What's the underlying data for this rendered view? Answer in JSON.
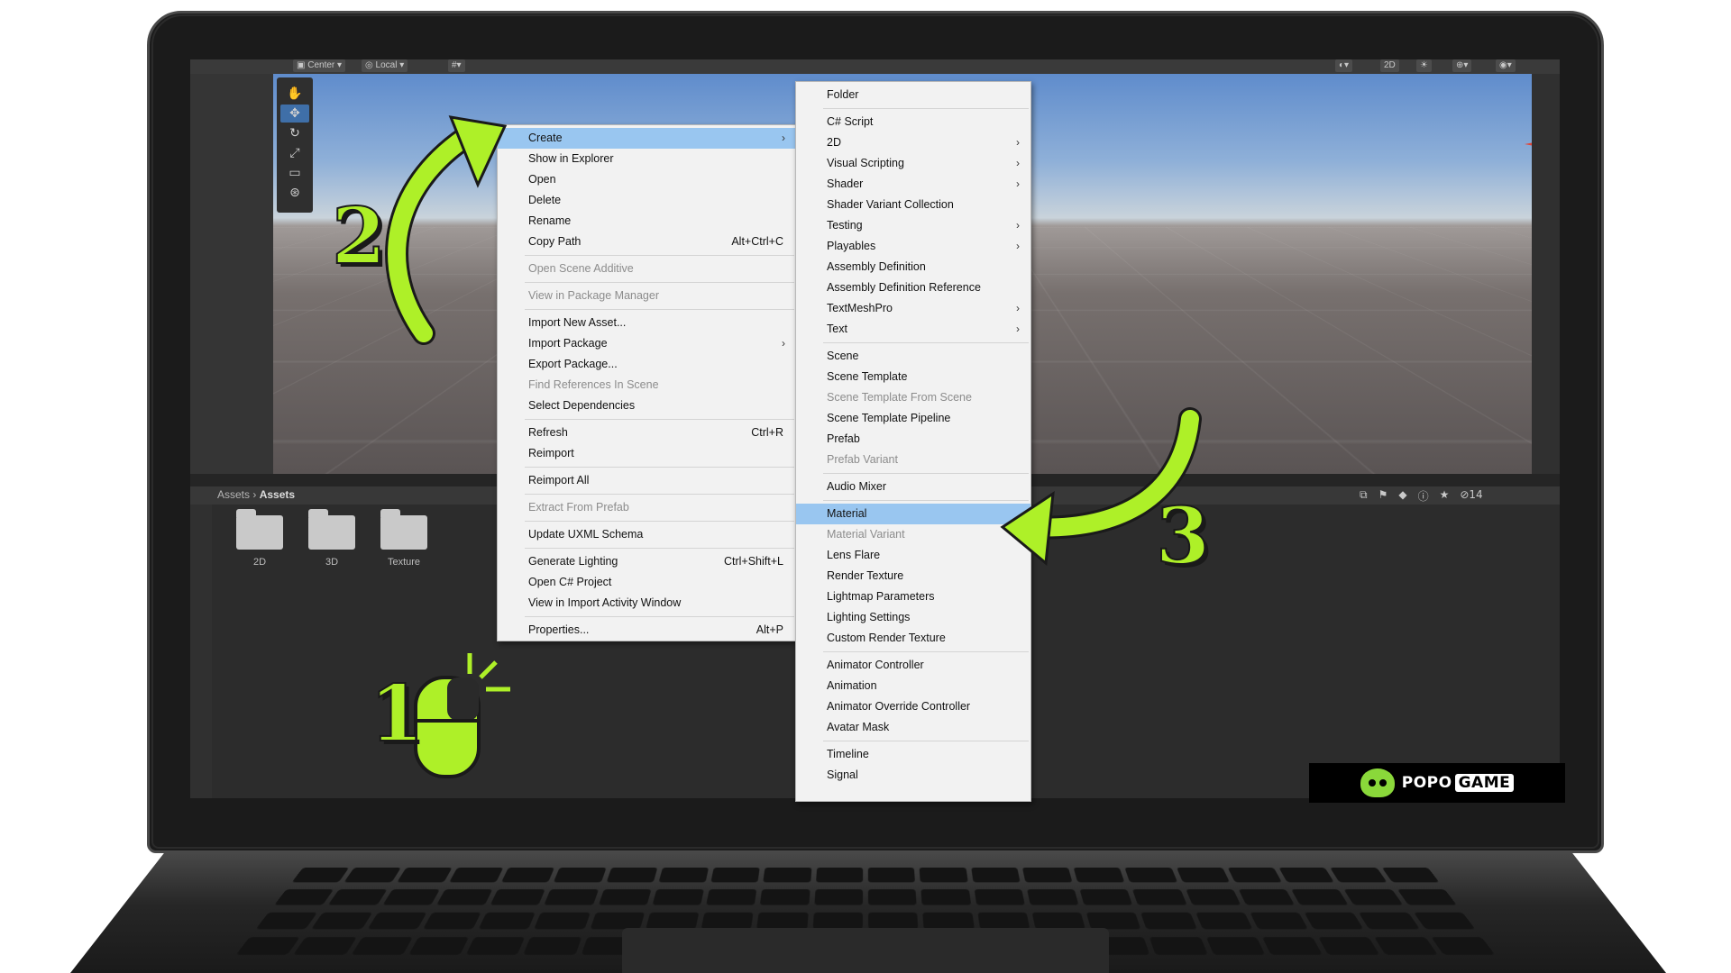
{
  "toolbar": {
    "pivot_center": "Center",
    "pivot_local": "Local",
    "mode_2d": "2D"
  },
  "project": {
    "breadcrumb_root": "Assets",
    "breadcrumb_current": "Assets",
    "folders": [
      "2D",
      "3D",
      "Texture"
    ],
    "visible_count": "14"
  },
  "context_menu": {
    "items": [
      {
        "label": "Create",
        "submenu": true,
        "highlighted": true
      },
      {
        "label": "Show in Explorer"
      },
      {
        "label": "Open"
      },
      {
        "label": "Delete"
      },
      {
        "label": "Rename"
      },
      {
        "label": "Copy Path",
        "shortcut": "Alt+Ctrl+C"
      },
      {
        "label": "Open Scene Additive",
        "disabled": true
      },
      {
        "label": "View in Package Manager",
        "disabled": true
      },
      {
        "label": "Import New Asset..."
      },
      {
        "label": "Import Package",
        "submenu": true
      },
      {
        "label": "Export Package..."
      },
      {
        "label": "Find References In Scene",
        "disabled": true
      },
      {
        "label": "Select Dependencies"
      },
      {
        "label": "Refresh",
        "shortcut": "Ctrl+R"
      },
      {
        "label": "Reimport"
      },
      {
        "label": "Reimport All"
      },
      {
        "label": "Extract From Prefab",
        "disabled": true
      },
      {
        "label": "Update UXML Schema"
      },
      {
        "label": "Generate Lighting",
        "shortcut": "Ctrl+Shift+L"
      },
      {
        "label": "Open C# Project"
      },
      {
        "label": "View in Import Activity Window"
      },
      {
        "label": "Properties...",
        "shortcut": "Alt+P"
      }
    ]
  },
  "create_submenu": {
    "items": [
      {
        "label": "Folder"
      },
      {
        "label": "C# Script"
      },
      {
        "label": "2D",
        "submenu": true
      },
      {
        "label": "Visual Scripting",
        "submenu": true
      },
      {
        "label": "Shader",
        "submenu": true
      },
      {
        "label": "Shader Variant Collection"
      },
      {
        "label": "Testing",
        "submenu": true
      },
      {
        "label": "Playables",
        "submenu": true
      },
      {
        "label": "Assembly Definition"
      },
      {
        "label": "Assembly Definition Reference"
      },
      {
        "label": "TextMeshPro",
        "submenu": true
      },
      {
        "label": "Text",
        "submenu": true
      },
      {
        "label": "Scene"
      },
      {
        "label": "Scene Template"
      },
      {
        "label": "Scene Template From Scene",
        "disabled": true
      },
      {
        "label": "Scene Template Pipeline"
      },
      {
        "label": "Prefab"
      },
      {
        "label": "Prefab Variant",
        "disabled": true
      },
      {
        "label": "Audio Mixer"
      },
      {
        "label": "Material",
        "highlighted": true
      },
      {
        "label": "Material Variant",
        "disabled": true
      },
      {
        "label": "Lens Flare"
      },
      {
        "label": "Render Texture"
      },
      {
        "label": "Lightmap Parameters"
      },
      {
        "label": "Lighting Settings"
      },
      {
        "label": "Custom Render Texture"
      },
      {
        "label": "Animator Controller"
      },
      {
        "label": "Animation"
      },
      {
        "label": "Animator Override Controller"
      },
      {
        "label": "Avatar Mask"
      },
      {
        "label": "Timeline"
      },
      {
        "label": "Signal"
      }
    ]
  },
  "annotations": {
    "step_1": "1",
    "step_2": "2",
    "step_3": "3",
    "accent_color": "#aef028"
  },
  "brand": {
    "name_part1": "POPO",
    "name_part2": "GAME"
  }
}
